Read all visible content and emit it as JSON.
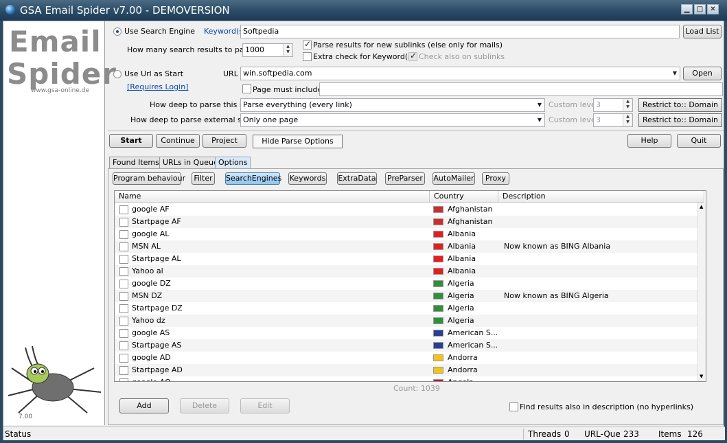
{
  "window": {
    "title": "GSA Email Spider v7.00 - DEMOVERSION"
  },
  "logo": {
    "line1": "Email",
    "line2": "Spider",
    "url": "www.gsa-online.de",
    "version": "7.00"
  },
  "search": {
    "use_search_engine_label": "Use Search Engine",
    "keywords_label": "Keyword(s)",
    "keywords_value": "Softpedia",
    "load_list_label": "Load List",
    "results_label": "How many search results to parse",
    "results_value": "1000",
    "parse_sublinks_label": "Parse results for new sublinks (else only for mails)",
    "extra_check_label": "Extra check for Keyword(s)",
    "check_sublinks_label": "Check also on sublinks"
  },
  "url_start": {
    "use_url_label": "Use Url as Start",
    "url_label": "URL",
    "url_value": "win.softpedia.com",
    "open_label": "Open",
    "requires_login_label": "[Requires Login]",
    "page_must_include_label": "Page must include",
    "depth_site_label": "How deep to parse this site",
    "depth_site_value": "Parse everything (every link)",
    "custom_level_label": "Custom level",
    "custom_level_value": "3",
    "restrict_label": "Restrict to:: Domain",
    "depth_external_label": "How deep to parse external sites",
    "depth_external_value": "Only one page"
  },
  "actions": {
    "start": "Start",
    "continue": "Continue",
    "project": "Project",
    "hide_parse": "Hide Parse Options",
    "help": "Help",
    "quit": "Quit"
  },
  "tabs": [
    "Found Items",
    "URLs in Queue",
    "Options"
  ],
  "subtabs": [
    "Program behaviour",
    "Filter",
    "SearchEngines",
    "Keywords",
    "ExtraData",
    "PreParser",
    "AutoMailer",
    "Proxy"
  ],
  "table": {
    "columns": [
      "Name",
      "Country",
      "Description"
    ],
    "rows": [
      {
        "name": "google AF",
        "country": "Afghanistan",
        "desc": "",
        "flag": "#c8302d"
      },
      {
        "name": "Startpage AF",
        "country": "Afghanistan",
        "desc": "",
        "flag": "#c8302d"
      },
      {
        "name": "google AL",
        "country": "Albania",
        "desc": "",
        "flag": "#e41e20"
      },
      {
        "name": "MSN AL",
        "country": "Albania",
        "desc": "Now known as BING Albania",
        "flag": "#e41e20"
      },
      {
        "name": "Startpage AL",
        "country": "Albania",
        "desc": "",
        "flag": "#e41e20"
      },
      {
        "name": "Yahoo al",
        "country": "Albania",
        "desc": "",
        "flag": "#e41e20"
      },
      {
        "name": "google DZ",
        "country": "Algeria",
        "desc": "",
        "flag": "#2f8f3a"
      },
      {
        "name": "MSN DZ",
        "country": "Algeria",
        "desc": "Now known as BING Algeria",
        "flag": "#2f8f3a"
      },
      {
        "name": "Startpage DZ",
        "country": "Algeria",
        "desc": "",
        "flag": "#2f8f3a"
      },
      {
        "name": "Yahoo dz",
        "country": "Algeria",
        "desc": "",
        "flag": "#2f8f3a"
      },
      {
        "name": "google AS",
        "country": "American S...",
        "desc": "",
        "flag": "#2b3f8f"
      },
      {
        "name": "Startpage AS",
        "country": "American S...",
        "desc": "",
        "flag": "#2b3f8f"
      },
      {
        "name": "google AD",
        "country": "Andorra",
        "desc": "",
        "flag": "#f2c318"
      },
      {
        "name": "Startpage AD",
        "country": "Andorra",
        "desc": "",
        "flag": "#f2c318"
      },
      {
        "name": "google AO",
        "country": "Angola",
        "desc": "",
        "flag": "#cc092f"
      }
    ],
    "count": "Count: 1039"
  },
  "bottom": {
    "add": "Add",
    "delete": "Delete",
    "edit": "Edit",
    "find_desc_label": "Find results also in description (no hyperlinks)"
  },
  "status": {
    "status": "Status",
    "threads_label": "Threads",
    "threads": "0",
    "urlque_label": "URL-Que",
    "urlque": "233",
    "items_label": "Items",
    "items": "126"
  }
}
